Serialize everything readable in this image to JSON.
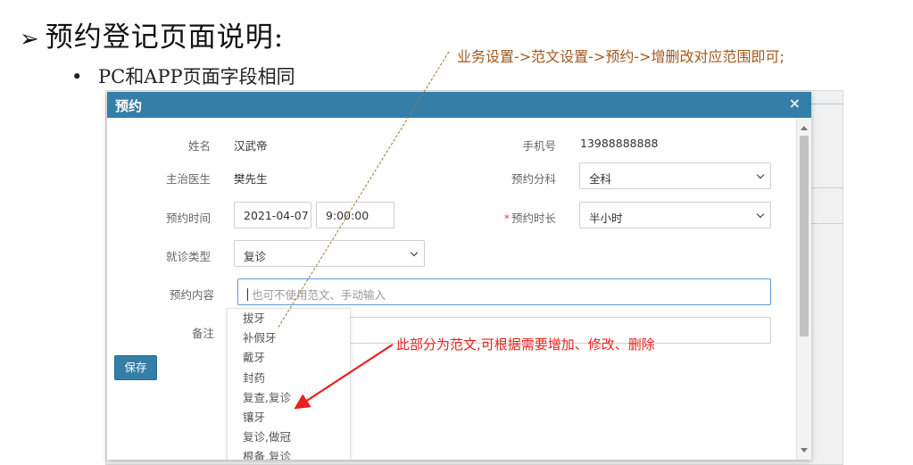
{
  "slide": {
    "title": "预约登记页面说明:",
    "bullet": "PC和APP页面字段相同",
    "note_top": "业务设置->范文设置->预约->增删改对应范围即可;",
    "note_red": "此部分为范文,可根据需要增加、修改、删除"
  },
  "modal": {
    "title": "预约",
    "close": "×",
    "fields": {
      "name_label": "姓名",
      "name_value": "汉武帝",
      "phone_label": "手机号",
      "phone_value": "13988888888",
      "doctor_label": "主治医生",
      "doctor_value": "樊先生",
      "dept_label": "预约分科",
      "dept_value": "全科",
      "time_label": "预约时间",
      "date_value": "2021-04-07",
      "time_value": "9:00:00",
      "duration_label": "预约时长",
      "duration_required": "*",
      "duration_value": "半小时",
      "visit_label": "就诊类型",
      "visit_value": "复诊",
      "content_label": "预约内容",
      "content_placeholder": "也可不使用范文、手动输入",
      "remark_label": "备注"
    },
    "save_label": "保存",
    "suggestions": [
      "拔牙",
      "补假牙",
      "戴牙",
      "封药",
      "复查,复诊",
      "镶牙",
      "复诊,做冠",
      "根备,复诊"
    ]
  },
  "colors": {
    "header_blue": "#357ea8",
    "annotation_red": "#e8221f",
    "annotation_brown": "#a0581e"
  }
}
